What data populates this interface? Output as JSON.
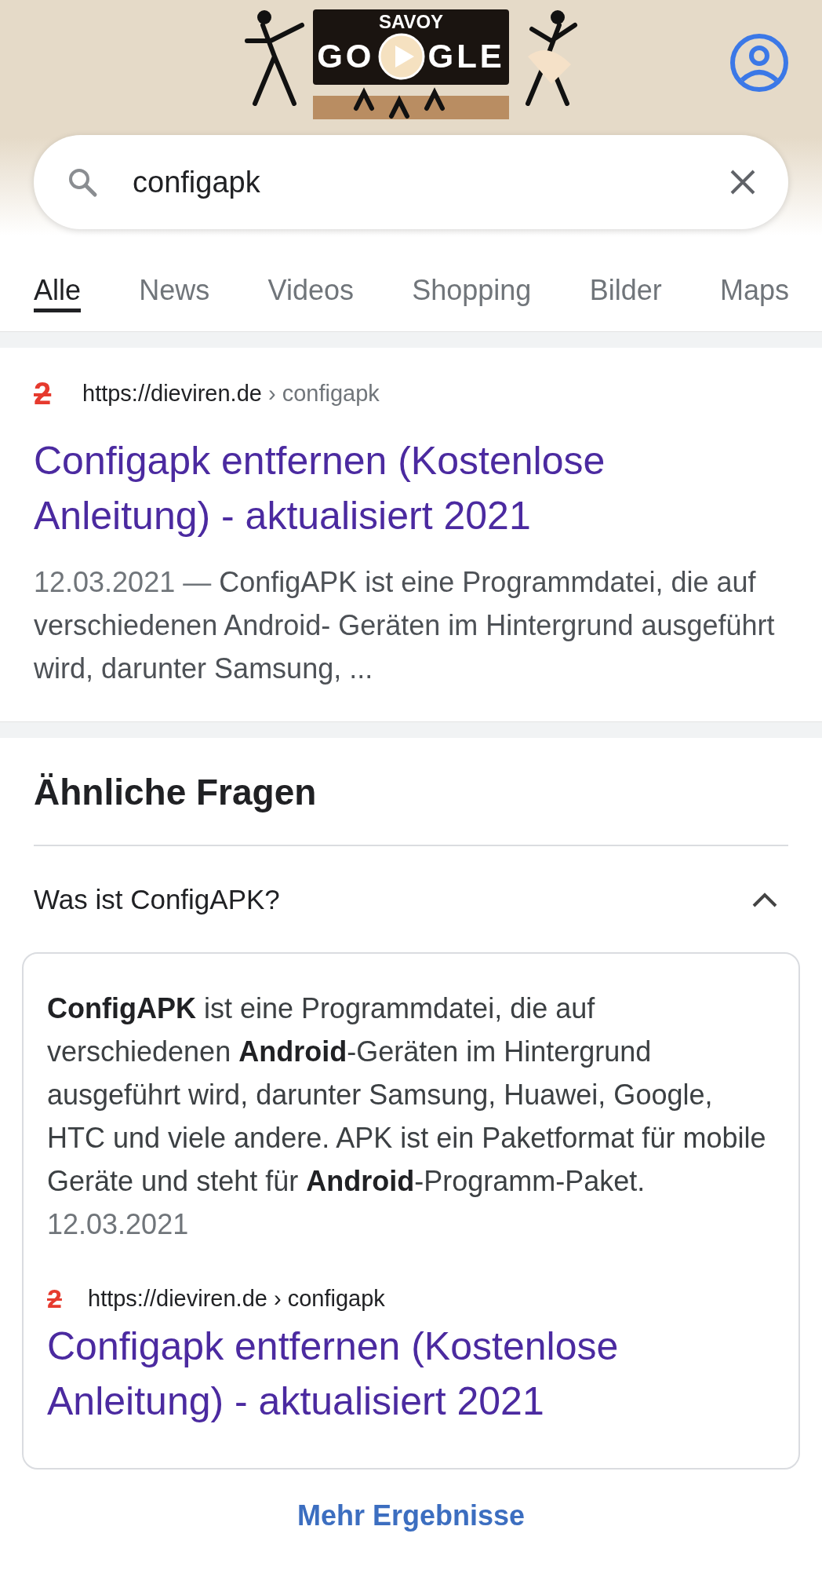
{
  "doodle": {
    "marquee": "SAVOY",
    "left": "GO",
    "right": "GLE"
  },
  "search": {
    "value": "configapk"
  },
  "tabs": [
    {
      "label": "Alle",
      "selected": true
    },
    {
      "label": "News",
      "selected": false
    },
    {
      "label": "Videos",
      "selected": false
    },
    {
      "label": "Shopping",
      "selected": false
    },
    {
      "label": "Bilder",
      "selected": false
    },
    {
      "label": "Maps",
      "selected": false
    }
  ],
  "result": {
    "favicon": "2",
    "site": "https://dieviren.de",
    "path": "› configapk",
    "title": "Configapk entfernen (Kostenlose Anleitung) - aktualisiert 2021",
    "date": "12.03.2021 —",
    "snippet": "ConfigAPK ist eine Programmdatei, die auf verschiedenen Android- Geräten im Hintergrund ausgeführt wird, darunter Samsung, ..."
  },
  "related": {
    "heading": "Ähnliche Fragen",
    "questions": [
      {
        "question": "Was ist ConfigAPK?",
        "expanded": true,
        "answer": "**ConfigAPK** ist eine Programmdatei, die auf verschiedenen **Android**-Geräten im Hintergrund ausgeführt wird, darunter Samsung, Huawei, Google, HTC und viele andere. APK ist ein Paketformat für mobile Geräte und steht für **Android**-Programm-Paket.",
        "date": "12.03.2021",
        "source": {
          "favicon": "2",
          "site": "https://dieviren.de",
          "path": "› configapk",
          "title": "Configapk entfernen (Kostenlose Anleitung) - aktualisiert 2021"
        }
      }
    ],
    "more": "Mehr Ergebnisse"
  }
}
